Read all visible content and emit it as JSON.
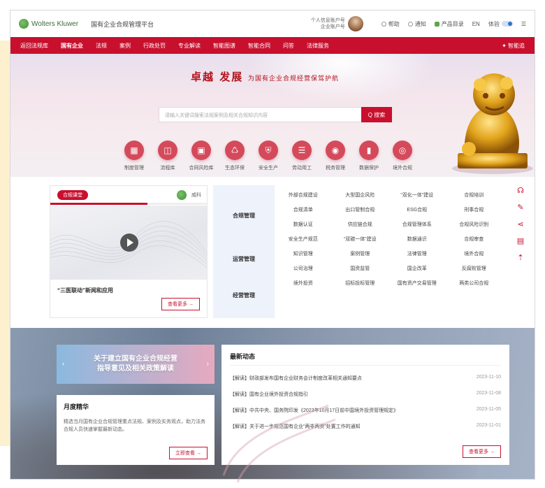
{
  "topbar": {
    "logo_text": "Wolters Kluwer",
    "platform_name": "国有企业合规管理平台",
    "user_line1": "个人信息账户号",
    "user_line2": "企业账户号",
    "links": [
      "帮助",
      "通知",
      "产品目录",
      "EN",
      "体验"
    ]
  },
  "nav": {
    "items": [
      "返回法规库",
      "国有企业",
      "法规",
      "案例",
      "行政处罚",
      "专业解读",
      "智能图谱",
      "智能合同",
      "问答",
      "法律服务"
    ],
    "active_index": 1,
    "right_label": "智能追"
  },
  "hero": {
    "slogan": "卓越 发展",
    "slogan_sub": "为国有企业合规经营保驾护航",
    "search_placeholder": "请输入关键词搜索法规案例及相关合规知识内容",
    "search_button": "Q 搜索",
    "features": [
      {
        "label": "制度管理",
        "icon": "grid-icon",
        "glyph": "▦"
      },
      {
        "label": "流程库",
        "icon": "stack-icon",
        "glyph": "◫"
      },
      {
        "label": "合同风险库",
        "icon": "screen-icon",
        "glyph": "▣"
      },
      {
        "label": "生态环保",
        "icon": "leaf-icon",
        "glyph": "♺"
      },
      {
        "label": "安全生产",
        "icon": "shield-icon",
        "glyph": "⛨"
      },
      {
        "label": "劳动用工",
        "icon": "document-icon",
        "glyph": "☰"
      },
      {
        "label": "税务管理",
        "icon": "tax-icon",
        "glyph": "◉"
      },
      {
        "label": "数据保护",
        "icon": "chart-icon",
        "glyph": "▮"
      },
      {
        "label": "境外合规",
        "icon": "globe-icon",
        "glyph": "◎"
      }
    ]
  },
  "video": {
    "badge": "合规课堂",
    "brand_label": "威科",
    "progress": 0.62,
    "title": "“三医联动”新闻和应用",
    "more": "查看更多 →"
  },
  "categories": {
    "groups": [
      "合规管理",
      "运营管理",
      "经营管理"
    ],
    "cells": [
      "外部合规建设",
      "大型国企风险",
      "“双化一体”建设",
      "合规培训",
      "合规清单",
      "出口管制合规",
      "ESG合规",
      "刑事合规",
      "数据认证",
      "供应链合规",
      "合规管理体系",
      "合规风险识别",
      "安全生产规范",
      "“双碳一体”建设",
      "数据通识",
      "合规审查",
      "知识管理",
      "案例管理",
      "法律管理",
      "境外合规",
      "公司治理",
      "国资监管",
      "国企改革",
      "反腐败管理",
      "境外投资",
      "招标投标管理",
      "国有资产交易管理",
      "两类公司合规"
    ]
  },
  "side_tools": [
    "support-icon",
    "feedback-icon",
    "share-icon",
    "book-icon",
    "top-icon"
  ],
  "banner": {
    "line1": "关于建立国有企业合规经营",
    "line2": "指导意见及相关政策解读"
  },
  "feature": {
    "title": "月度精华",
    "desc": "精选当月国有企业合规管理重点法规、案例及实务观点，助力法务合规人员快速掌握最新动态。",
    "button": "立即查看 →"
  },
  "news": {
    "title": "最新动态",
    "items": [
      {
        "text": "【解读】财政部发布国有企业财务会计制度改革相关通知要点",
        "date": "2023-11-10"
      },
      {
        "text": "【解读】国有企业境外投资合规指引",
        "date": "2023-11-08"
      },
      {
        "text": "【解读】中共中央、国务院印发《2023年10月17日前中国境外投资管理规定》",
        "date": "2023-11-05"
      },
      {
        "text": "【解读】关于进一步规范国有企业“两非两资”处置工作的通知",
        "date": "2023-11-01"
      }
    ],
    "more": "查看更多 →"
  }
}
